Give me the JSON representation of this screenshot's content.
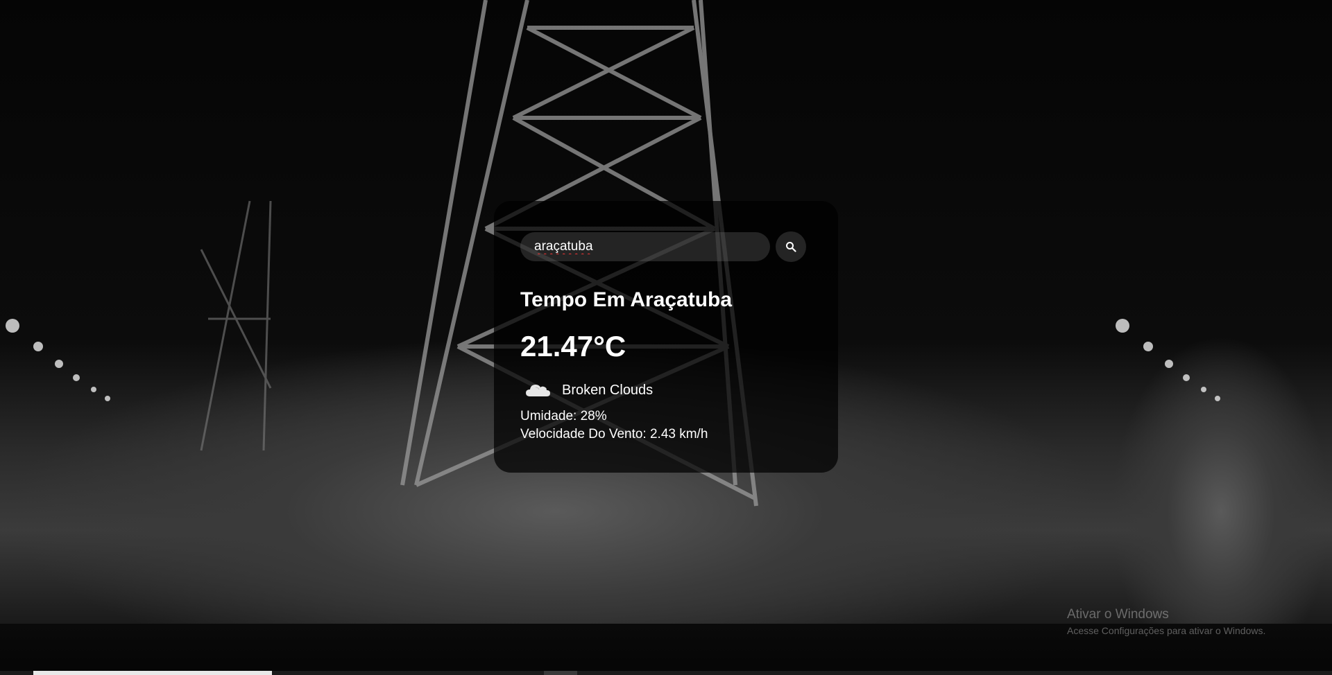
{
  "search": {
    "value": "araçatuba",
    "button_icon": "search-icon"
  },
  "weather": {
    "city_title": "Tempo Em Araçatuba",
    "temperature": "21.47°C",
    "icon": "cloud-icon",
    "description": "Broken Clouds",
    "humidity": "Umidade: 28%",
    "wind": "Velocidade Do Vento: 2.43 km/h"
  },
  "watermark": {
    "title": "Ativar o Windows",
    "subtitle": "Acesse Configurações para ativar o Windows."
  },
  "colors": {
    "card_background": "#000000",
    "text": "#ffffff",
    "input_background": "#7c7c7c"
  }
}
